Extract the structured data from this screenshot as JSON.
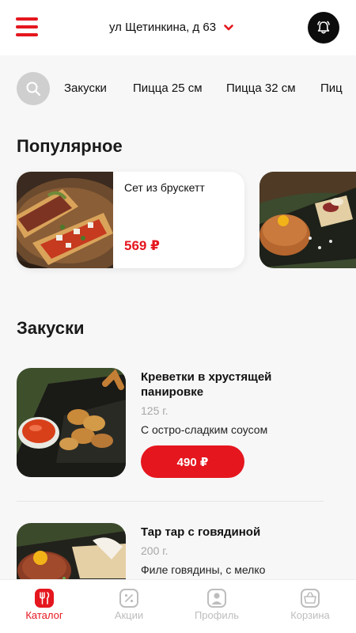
{
  "header": {
    "address": "ул Щетинкина, д 63"
  },
  "categories": [
    "Закуски",
    "Пицца 25 см",
    "Пицца 32 см",
    "Пиц"
  ],
  "sections": {
    "popular": "Популярное",
    "snacks": "Закуски"
  },
  "popular": [
    {
      "name": "Сет из брускетт",
      "price": "569 ₽"
    }
  ],
  "items": [
    {
      "title": "Креветки в хрустящей панировке",
      "weight": "125 г.",
      "desc": "С остро-сладким соусом",
      "price": "490 ₽"
    },
    {
      "title": "Тар тар с говядиной",
      "weight": "200 г.",
      "desc": "Филе говядины, с мелко"
    }
  ],
  "tabs": [
    {
      "label": "Каталог",
      "icon": "catalog-icon"
    },
    {
      "label": "Акции",
      "icon": "percent-icon"
    },
    {
      "label": "Профиль",
      "icon": "profile-icon"
    },
    {
      "label": "Корзина",
      "icon": "basket-icon"
    }
  ],
  "colors": {
    "accent": "#e5161e",
    "inactive": "#bdbdbd",
    "background": "#f7f7f7"
  }
}
